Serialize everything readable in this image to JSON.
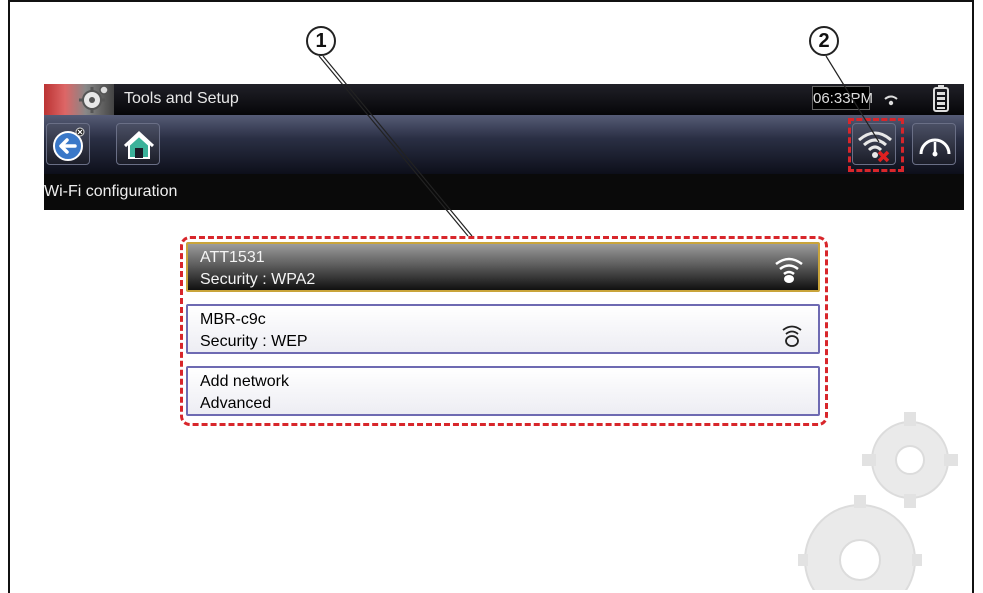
{
  "header": {
    "title": "Tools and Setup",
    "time": "06:33PM"
  },
  "toolbar": {
    "back_icon": "back-arrow-icon",
    "home_icon": "home-icon",
    "wifi_icon": "wifi-disconnected-icon",
    "gauge_icon": "gauge-icon"
  },
  "page": {
    "subtitle": "Wi-Fi configuration"
  },
  "networks": [
    {
      "name": "ATT1531",
      "security": "Security : WPA2",
      "signal_icon": "wifi-strong-icon",
      "selected": true
    },
    {
      "name": "MBR-c9c",
      "security": "Security : WEP",
      "signal_icon": "wifi-weak-icon",
      "selected": false
    }
  ],
  "options": {
    "add_network": "Add network",
    "advanced": "Advanced"
  },
  "callouts": {
    "one": "1",
    "two": "2"
  },
  "colors": {
    "highlight_dash": "#d8262b",
    "list_border": "#6e6ab2",
    "selected_border": "#c9a43a"
  }
}
